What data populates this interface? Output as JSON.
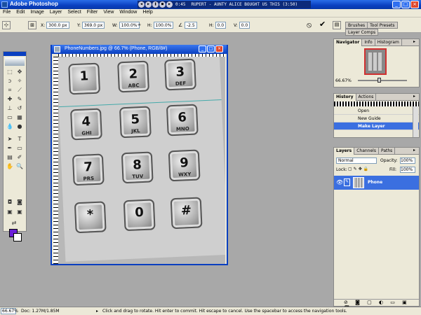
{
  "titlebar": {
    "title": "Adobe Photoshop"
  },
  "media_player": {
    "time": "0:45",
    "track": "RUPERT - AUNTY ALICE BOUGHT US THIS (3:50)"
  },
  "menu": [
    "File",
    "Edit",
    "Image",
    "Layer",
    "Select",
    "Filter",
    "View",
    "Window",
    "Help"
  ],
  "options": {
    "x_label": "X:",
    "x_value": "300.0 px",
    "y_label": "Y:",
    "y_value": "369.0 px",
    "w_label": "W:",
    "w_value": "100.0%",
    "h_label": "H:",
    "h_value": "100.0%",
    "angle_value": "-2.5",
    "h_skew_label": "H:",
    "h_skew_value": "0.0",
    "v_skew_label": "V:",
    "v_skew_value": "0.0",
    "tabs": [
      "Brushes",
      "Tool Presets",
      "Layer Comps"
    ]
  },
  "document": {
    "title": "PhoneNumbers.jpg @ 66.7% (Phone, RGB/8#)",
    "keys": [
      {
        "num": "1",
        "letters": ""
      },
      {
        "num": "2",
        "letters": "ABC"
      },
      {
        "num": "3",
        "letters": "DEF"
      },
      {
        "num": "4",
        "letters": "GHI"
      },
      {
        "num": "5",
        "letters": "JKL"
      },
      {
        "num": "6",
        "letters": "MNO"
      },
      {
        "num": "7",
        "letters": "PRS"
      },
      {
        "num": "8",
        "letters": "TUV"
      },
      {
        "num": "9",
        "letters": "WXY"
      },
      {
        "num": "*",
        "letters": ""
      },
      {
        "num": "0",
        "letters": ""
      },
      {
        "num": "#",
        "letters": ""
      }
    ]
  },
  "navigator": {
    "tabs": [
      "Navigator",
      "Info",
      "Histogram"
    ],
    "zoom": "66.67%"
  },
  "history": {
    "tabs": [
      "History",
      "Actions"
    ],
    "items": [
      "Open",
      "New Guide",
      "Make Layer"
    ]
  },
  "layers": {
    "tabs": [
      "Layers",
      "Channels",
      "Paths"
    ],
    "blend_mode": "Normal",
    "opacity_label": "Opacity:",
    "opacity": "100%",
    "lock_label": "Lock:",
    "fill_label": "Fill:",
    "fill": "100%",
    "layer_name": "Phone"
  },
  "status": {
    "zoom": "66.67%",
    "doc": "Doc: 1.27M/1.85M",
    "message": "Click and drag to rotate. Hit enter to commit. Hit escape to cancel. Use the spacebar to access the navigation tools."
  },
  "colors": {
    "foreground": "#6a1fd8",
    "background": "#ffffff",
    "selection": "#3b6fe0"
  }
}
